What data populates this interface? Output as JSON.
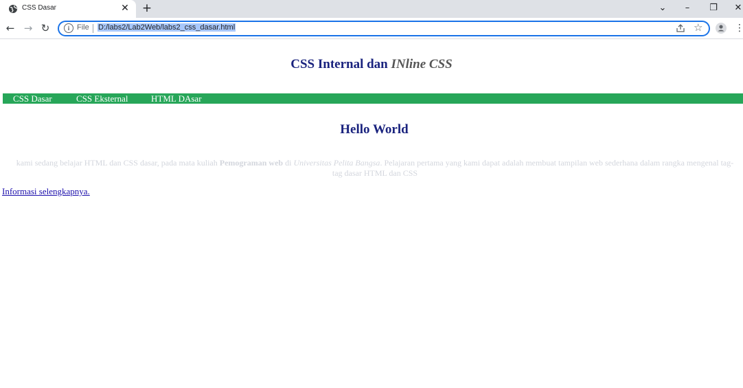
{
  "browser": {
    "tab_title": "CSS Dasar",
    "scheme_label": "File",
    "url": "D:/labs2/Lab2Web/labs2_css_dasar.html"
  },
  "page": {
    "heading_main": "CSS Internal dan ",
    "heading_inline": "INline CSS",
    "nav": [
      "CSS Dasar",
      "CSS Eksternal",
      "HTML DAsar"
    ],
    "hello": "Hello World",
    "paragraph": {
      "part1": "kami sedang belajar HTML dan CSS dasar, pada mata kuliah ",
      "bold": "Pemograman web",
      "part2": " di ",
      "italic": "Universitas Pelita Bangsa",
      "part3": ". Pelajaran pertama yang kami dapat adalah membuat tampilan web sederhana dalam rangka mengenal tag-tag dasar HTML dan CSS"
    },
    "more_link": "Informasi selengkapnya."
  },
  "colors": {
    "nav_bg": "#27a659",
    "heading": "#1a237e",
    "paragraph": "#d3d6dd",
    "omnibox_border": "#1a73e8"
  }
}
